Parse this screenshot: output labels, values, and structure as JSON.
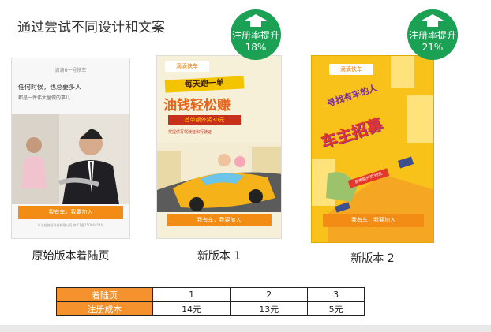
{
  "title": "通过尝试不同设计和文案",
  "pages": [
    {
      "caption": "原始版本着陆页",
      "app_header": "滴滴6一号快车",
      "slogan": "任何时候，也总要多人",
      "slogan_sub": "都是一件伟大里做的事儿",
      "cta": "我有车，我要加入",
      "footer": "©小桔快智科技有限公司 京ICP备15006454号"
    },
    {
      "caption": "新版本 1",
      "logo": "滴滴快车",
      "headline": "每天跑一单",
      "main": "油钱轻松赚",
      "promo": "首单额外奖30元",
      "note": "奖提供写驾驶证和行驶证",
      "cta": "我有车，我要加入"
    },
    {
      "caption": "新版本 2",
      "logo": "滴滴快车",
      "headline": "寻找有车的人",
      "main": "车主招募",
      "promo": "首单额外奖30元",
      "cta": "我有车，我要加入"
    }
  ],
  "badges": [
    {
      "label": "注册率提升",
      "value": "18%"
    },
    {
      "label": "注册率提升",
      "value": "21%"
    }
  ],
  "table": {
    "rows": [
      {
        "header": "着陆页",
        "cells": [
          "1",
          "2",
          "3"
        ]
      },
      {
        "header": "注册成本",
        "cells": [
          "14元",
          "13元",
          "5元"
        ]
      }
    ]
  },
  "colors": {
    "badge": "#1aa153",
    "cta": "#f28c14",
    "table_header": "#f5922e"
  }
}
